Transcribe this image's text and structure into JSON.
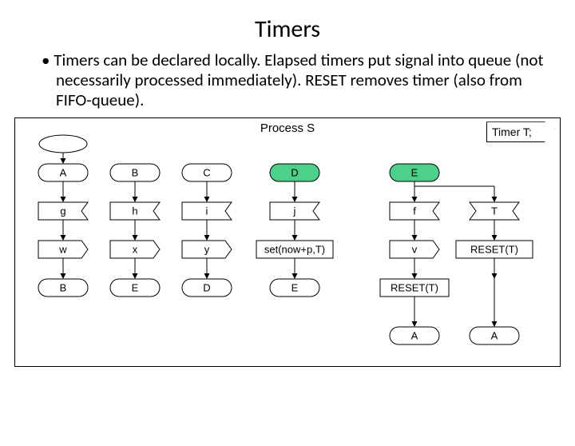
{
  "title": "Timers",
  "bullet": "Timers can be declared locally. Elapsed timers put signal into queue (not necessarily processed immediately). RESET removes timer (also from FIFO-queue).",
  "diagram": {
    "process_title": "Process S",
    "timer_decl": "Timer T;",
    "columns": [
      {
        "state_top": "A",
        "input": "g",
        "output": "w",
        "state_bot": "B"
      },
      {
        "state_top": "B",
        "input": "h",
        "output": "x",
        "state_bot": "E"
      },
      {
        "state_top": "C",
        "input": "i",
        "output": "y",
        "state_bot": "D"
      },
      {
        "state_top": "D",
        "input": "j",
        "output": "set(now+p,T)",
        "state_bot": "E",
        "highlight_top": true,
        "wide_output": true
      },
      {
        "state_top": "E",
        "input": "f",
        "output": "v",
        "state_bot": "RESET(T)",
        "state_bot2": "A",
        "highlight_top": true
      },
      {
        "input": "T",
        "output": "RESET(T)",
        "state_bot2": "A",
        "wide_output": true,
        "timer_in": true
      }
    ],
    "start_state": true
  }
}
